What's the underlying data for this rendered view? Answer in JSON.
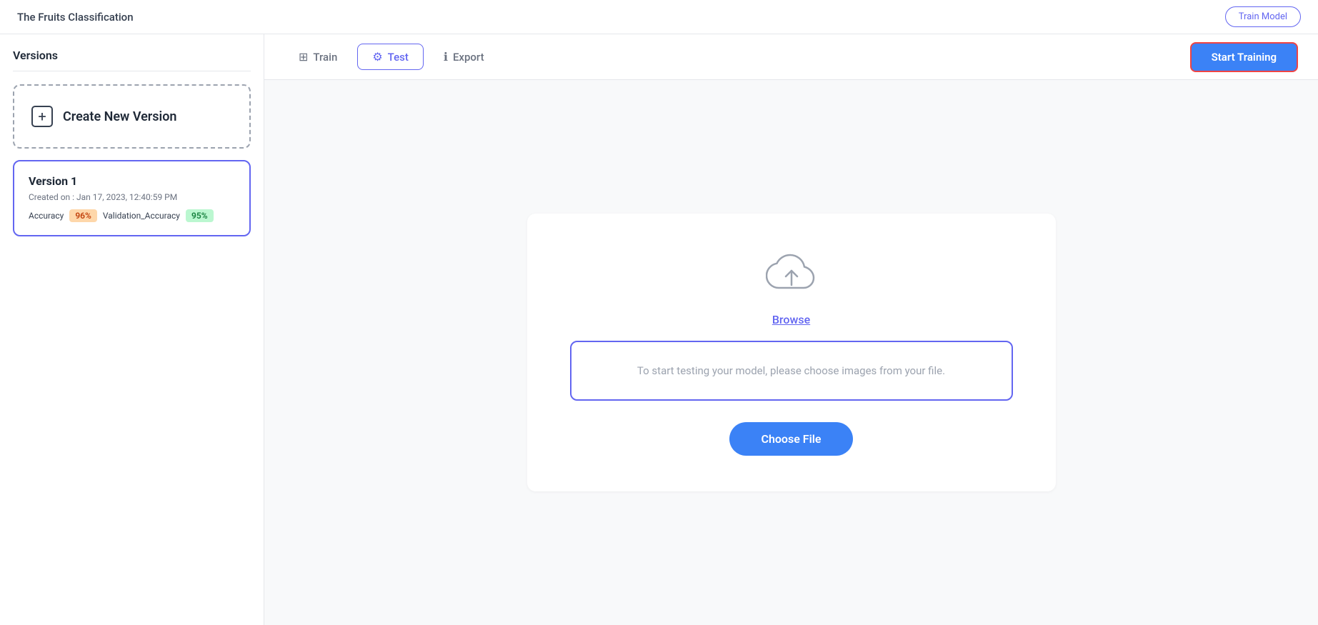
{
  "header": {
    "title": "The Fruits Classification",
    "train_model_label": "Train Model"
  },
  "sidebar": {
    "title": "Versions",
    "create_new_version_label": "Create New Version",
    "version_card": {
      "name": "Version 1",
      "date": "Created on : Jan 17, 2023, 12:40:59 PM",
      "accuracy_label": "Accuracy",
      "accuracy_value": "96%",
      "validation_label": "Validation_Accuracy",
      "validation_value": "95%"
    }
  },
  "tabs": {
    "train_label": "Train",
    "test_label": "Test",
    "export_label": "Export",
    "start_training_label": "Start Training"
  },
  "main": {
    "browse_label": "Browse",
    "drop_zone_text": "To start testing your model, please choose images from your file.",
    "choose_file_label": "Choose File"
  },
  "icons": {
    "train": "⊞",
    "test": "⚙",
    "export": "ℹ",
    "cloud_upload": "☁",
    "plus": "+"
  }
}
